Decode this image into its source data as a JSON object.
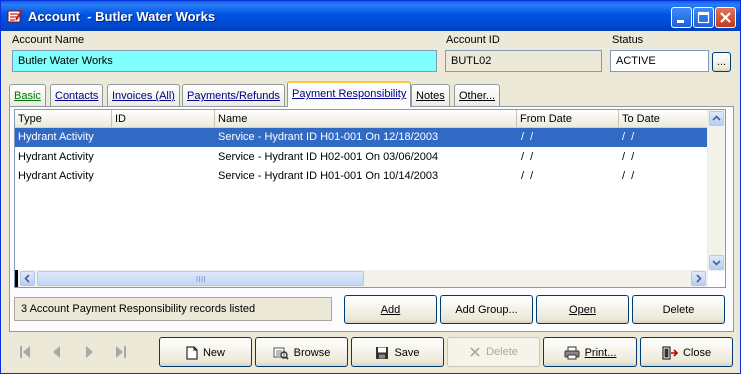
{
  "window": {
    "title": "Account  - Butler Water Works"
  },
  "header": {
    "account_name_label": "Account Name",
    "account_name_value": "Butler Water Works",
    "account_id_label": "Account ID",
    "account_id_value": "BUTL02",
    "status_label": "Status",
    "status_value": "ACTIVE",
    "status_lookup_label": "..."
  },
  "tabs": [
    {
      "label": "Basic"
    },
    {
      "label": "Contacts"
    },
    {
      "label": "Invoices (All)"
    },
    {
      "label": "Payments/Refunds"
    },
    {
      "label": "Payment Responsibility"
    },
    {
      "label": "Notes"
    },
    {
      "label": "Other..."
    }
  ],
  "active_tab": "Payment Responsibility",
  "grid": {
    "columns": [
      "Type",
      "ID",
      "Name",
      "From Date",
      "To Date"
    ],
    "rows": [
      {
        "type": "Hydrant Activity",
        "id": "",
        "name": "Service - Hydrant ID H01-001 On 12/18/2003",
        "from": "/  /",
        "to": "/  /"
      },
      {
        "type": "Hydrant Activity",
        "id": "",
        "name": "Service - Hydrant ID H02-001 On 03/06/2004",
        "from": "/  /",
        "to": "/  /"
      },
      {
        "type": "Hydrant Activity",
        "id": "",
        "name": "Service - Hydrant ID H01-001 On 10/14/2003",
        "from": "/  /",
        "to": "/  /"
      }
    ],
    "selected_row": 0
  },
  "status_text": "3 Account Payment Responsibility records listed",
  "panel_buttons": {
    "add": "Add",
    "add_group": "Add Group...",
    "open": "Open",
    "delete": "Delete"
  },
  "toolbar": {
    "new": "New",
    "browse": "Browse",
    "save": "Save",
    "delete": "Delete",
    "print": "Print...",
    "close": "Close"
  },
  "colors": {
    "title_bar": "#0054e3",
    "account_name_bg": "#80ffff",
    "selection": "#316ac5",
    "active_tab_accent": "#ffc83c"
  }
}
